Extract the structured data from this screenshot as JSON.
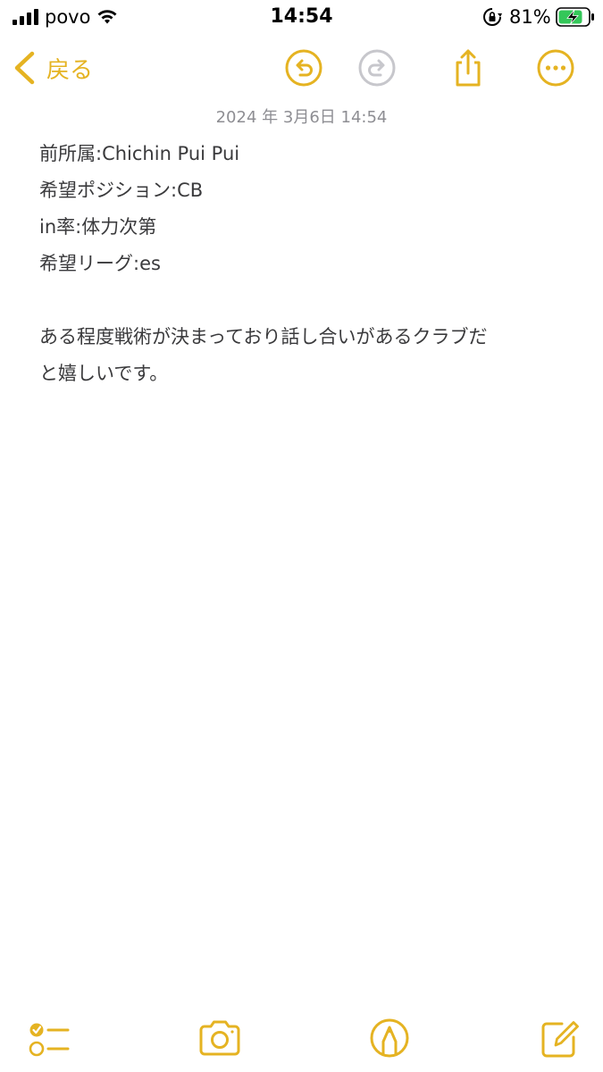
{
  "status_bar": {
    "carrier": "povo",
    "time": "14:54",
    "battery_percent": "81%"
  },
  "nav": {
    "back_label": "戻る",
    "icons": [
      "chevron-left-icon",
      "undo-icon",
      "redo-icon",
      "share-icon",
      "more-icon"
    ]
  },
  "note": {
    "date": "2024 年 3月6日 14:54",
    "lines": [
      "前所属:Chichin Pui Pui",
      "希望ポジション:CB",
      "in率:体力次第",
      "希望リーグ:es",
      "",
      "ある程度戦術が決まっており話し合いがあるクラブだ",
      "と嬉しいです。"
    ]
  },
  "toolbar": {
    "icons": [
      "checklist-icon",
      "camera-icon",
      "markup-icon",
      "compose-icon"
    ]
  },
  "colors": {
    "accent": "#e5b322",
    "disabled": "#c7c7cc",
    "text": "#3a3a3c",
    "date": "#8e8e93",
    "battery_green": "#34c759"
  }
}
